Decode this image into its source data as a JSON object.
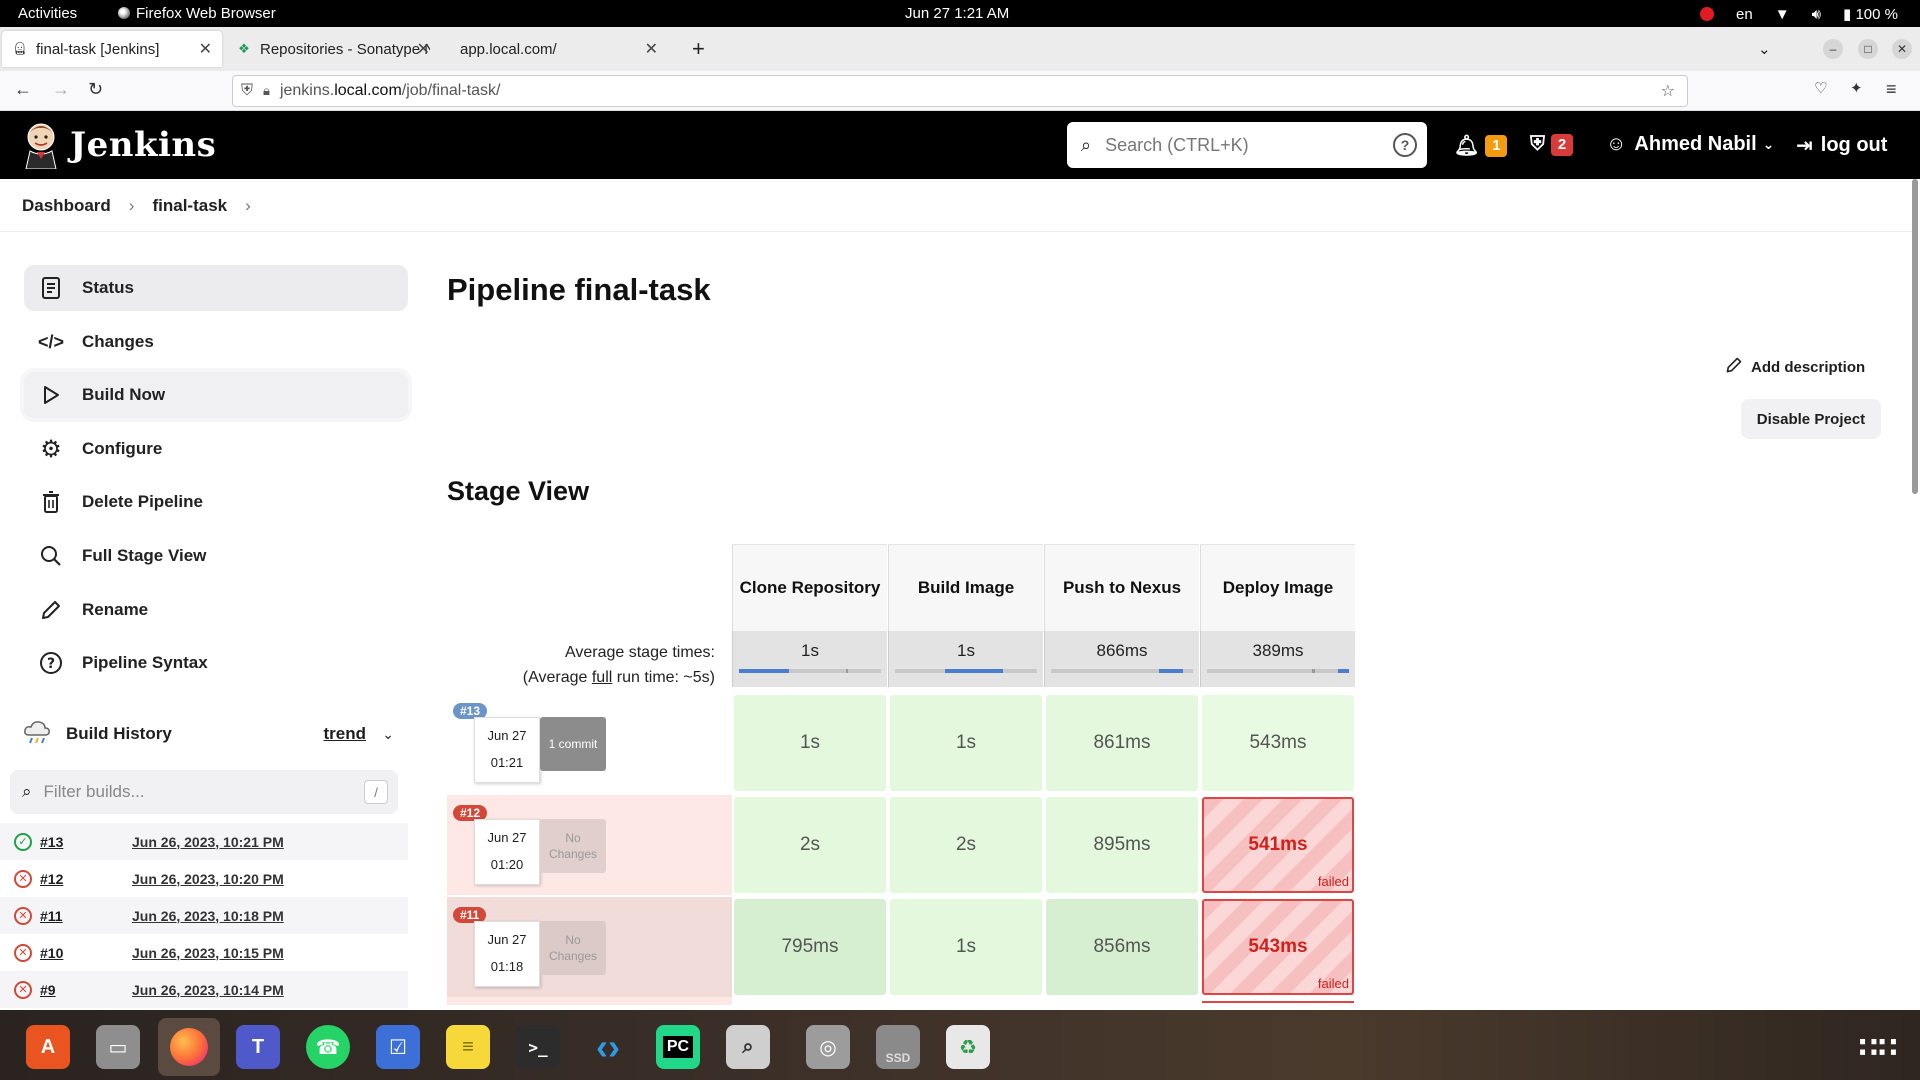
{
  "os": {
    "activities": "Activities",
    "app_name": "Firefox Web Browser",
    "clock": "Jun 27  1:21 AM",
    "lang": "en",
    "battery": "100 %"
  },
  "browser": {
    "tabs": [
      {
        "label": "final-task [Jenkins]"
      },
      {
        "label": "Repositories - Sonatype N"
      },
      {
        "label": "app.local.com/"
      }
    ],
    "url_prefix": "jenkins.",
    "url_host": "local.com",
    "url_path": "/job/final-task/"
  },
  "jenkins": {
    "brand": "Jenkins",
    "search_placeholder": "Search (CTRL+K)",
    "notifications_count": "1",
    "security_count": "2",
    "user": "Ahmed Nabil",
    "logout": "log out"
  },
  "breadcrumb": [
    "Dashboard",
    "final-task"
  ],
  "sidebar": {
    "items": [
      {
        "label": "Status",
        "icon": "document-icon"
      },
      {
        "label": "Changes",
        "icon": "code-icon"
      },
      {
        "label": "Build Now",
        "icon": "play-icon"
      },
      {
        "label": "Configure",
        "icon": "gear-icon"
      },
      {
        "label": "Delete Pipeline",
        "icon": "trash-icon"
      },
      {
        "label": "Full Stage View",
        "icon": "search-icon"
      },
      {
        "label": "Rename",
        "icon": "pencil-icon"
      },
      {
        "label": "Pipeline Syntax",
        "icon": "help-icon"
      }
    ]
  },
  "build_history": {
    "title": "Build History",
    "trend": "trend",
    "filter_placeholder": "Filter builds...",
    "filter_shortcut": "/",
    "rows": [
      {
        "num": "#13",
        "date": "Jun 26, 2023, 10:21 PM",
        "status": "success"
      },
      {
        "num": "#12",
        "date": "Jun 26, 2023, 10:20 PM",
        "status": "failed"
      },
      {
        "num": "#11",
        "date": "Jun 26, 2023, 10:18 PM",
        "status": "failed"
      },
      {
        "num": "#10",
        "date": "Jun 26, 2023, 10:15 PM",
        "status": "failed"
      },
      {
        "num": "#9",
        "date": "Jun 26, 2023, 10:14 PM",
        "status": "failed"
      }
    ]
  },
  "main": {
    "title": "Pipeline final-task",
    "add_description": "Add description",
    "disable_project": "Disable Project",
    "stage_view_title": "Stage View"
  },
  "stage_view": {
    "avg_label_1": "Average stage times:",
    "avg_label_2a": "(Average ",
    "avg_label_2b": "full",
    "avg_label_2c": " run time: ~5s)",
    "stages": [
      {
        "name": "Clone Repository",
        "avg": "1s"
      },
      {
        "name": "Build Image",
        "avg": "1s"
      },
      {
        "name": "Push to Nexus",
        "avg": "866ms"
      },
      {
        "name": "Deploy Image",
        "avg": "389ms"
      }
    ],
    "runs": [
      {
        "num": "#13",
        "date": "Jun 27",
        "time": "01:21",
        "changes": "1 commit",
        "cells": [
          "1s",
          "1s",
          "861ms",
          "543ms"
        ],
        "failed_stage": null
      },
      {
        "num": "#12",
        "date": "Jun 27",
        "time": "01:20",
        "changes": "No Changes",
        "cells": [
          "2s",
          "2s",
          "895ms",
          "541ms"
        ],
        "failed_stage": 3
      },
      {
        "num": "#11",
        "date": "Jun 27",
        "time": "01:18",
        "changes": "No Changes",
        "cells": [
          "795ms",
          "1s",
          "856ms",
          "543ms"
        ],
        "failed_stage": 3
      }
    ],
    "failed_label": "failed"
  },
  "colors": {
    "success_cell": "#e3f8dd",
    "success_cell_alt": "#d7efd1",
    "fail_border": "#e04545",
    "row_fail_bg": "#fde8e6",
    "row_fail_bg2": "#f5d9d6",
    "build_badge_ok": "#6b95c9",
    "build_badge_fail": "#d24939",
    "bar_blue": "#4a7fcf"
  },
  "dock": {
    "apps": [
      "ubuntu-software-icon",
      "files-icon",
      "firefox-icon",
      "teams-icon",
      "whatsapp-icon",
      "tasks-icon",
      "notes-icon",
      "terminal-icon",
      "vscode-icon",
      "pycharm-icon",
      "image-viewer-icon",
      "disks-icon",
      "ssd-icon",
      "trash-icon",
      "app-grid-icon"
    ],
    "pycharm_label": "PC",
    "ssd_label": "SSD"
  }
}
